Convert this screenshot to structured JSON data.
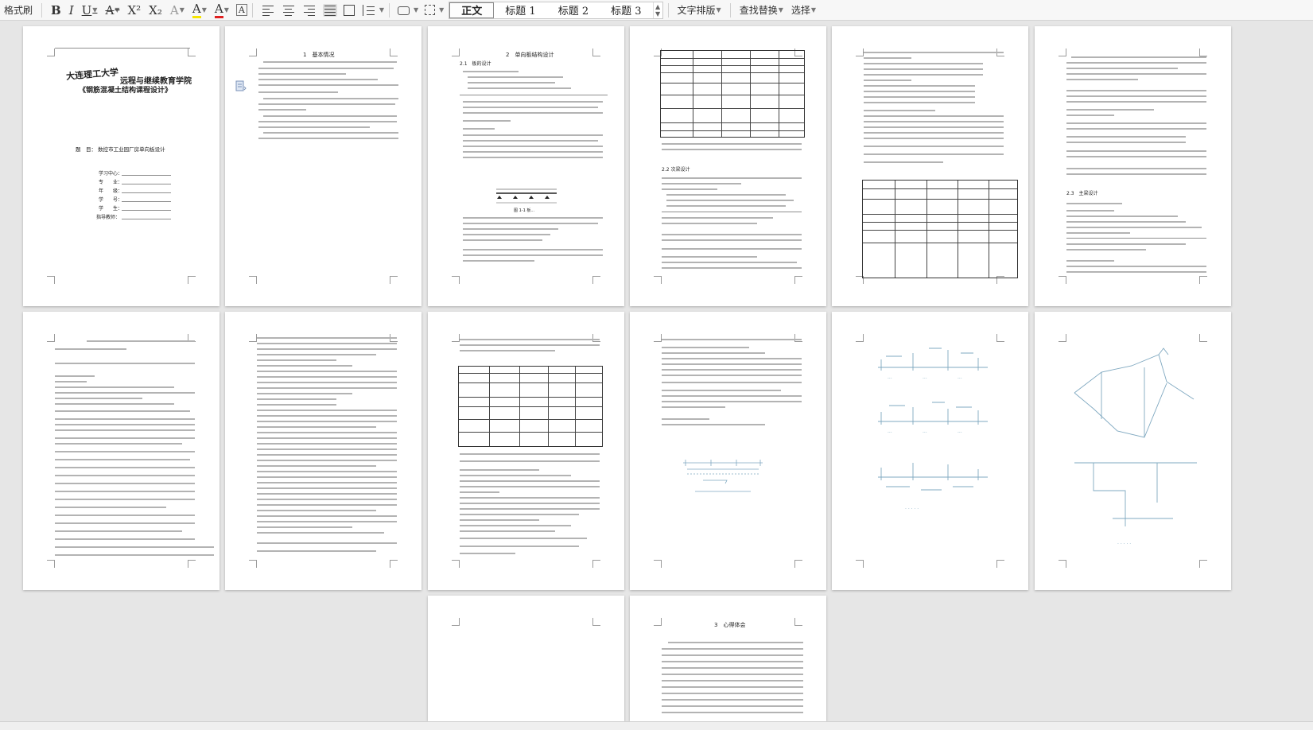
{
  "toolbar": {
    "format_painter": "格式刷",
    "bold": "B",
    "italic": "I",
    "underline": "U",
    "strike": "A",
    "superscript": "X²",
    "subscript": "X₂",
    "clear_format": "A",
    "highlight": "A",
    "font_color": "A",
    "char_border": "A",
    "styles": [
      "正文",
      "标题 1",
      "标题 2",
      "标题 3"
    ],
    "text_layout": "文字排版",
    "find_replace": "查找替换",
    "select": "选择"
  },
  "pages": {
    "cover": {
      "school_line1": "大连理工大学",
      "school_line2": "远程与继续教育学院",
      "course": "《钢筋混凝土结构课程设计》",
      "topic": "题　目：   数控市工业园厂房单向板设计",
      "fields": [
        "学习中心：",
        "专　　业：",
        "年　　级：",
        "学　　号：",
        "学　　生：",
        "指导教师："
      ]
    },
    "p1_heading": "1　基本情况",
    "p2_heading": "2　单向板结构设计",
    "p2_sub1": "2.1　板的设计",
    "p2_fig": "图 1-1 板...",
    "p3_sub": "2.2 次梁设计",
    "p5_sub": "2.3　主梁设计",
    "p12_heading": "3　心得体会"
  },
  "colors": {
    "canvas": "#e6e6e6",
    "page": "#ffffff",
    "sketch": "#7fa8c0"
  }
}
